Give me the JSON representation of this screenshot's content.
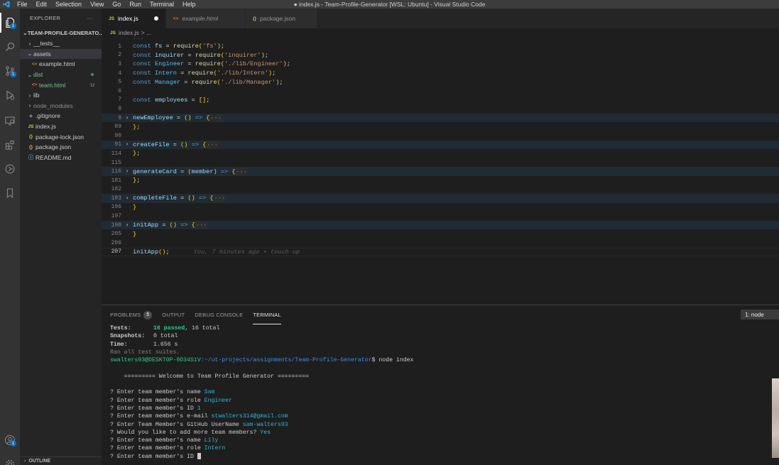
{
  "titlebar": {
    "menu": [
      "File",
      "Edit",
      "Selection",
      "View",
      "Go",
      "Run",
      "Terminal",
      "Help"
    ],
    "title": "● index.js - Team-Profile-Generator [WSL: Ubuntu] - Visual Studio Code"
  },
  "activity": {
    "explorer_badge": "1",
    "scm_badge": "1",
    "accounts_badge": "1"
  },
  "sidebar": {
    "header": "EXPLORER",
    "more": "···",
    "root": "TEAM-PROFILE-GENERATO...",
    "items": [
      {
        "label": "__tests__",
        "chev": "›",
        "indent": 1,
        "icon": ""
      },
      {
        "label": "assets",
        "chev": "⌄",
        "indent": 1,
        "icon": ""
      },
      {
        "label": "example.html",
        "chev": "",
        "indent": 2,
        "icon": "<>"
      },
      {
        "label": "dist",
        "chev": "⌄",
        "indent": 1,
        "icon": ""
      },
      {
        "label": "team.html",
        "chev": "",
        "indent": 2,
        "icon": "<>",
        "decor": "U"
      },
      {
        "label": "lib",
        "chev": "›",
        "indent": 1,
        "icon": ""
      },
      {
        "label": "node_modules",
        "chev": "›",
        "indent": 1,
        "icon": ""
      },
      {
        "label": ".gitignore",
        "chev": "",
        "indent": 1,
        "icon": "◆"
      },
      {
        "label": "index.js",
        "chev": "",
        "indent": 1,
        "icon": "JS"
      },
      {
        "label": "package-lock.json",
        "chev": "",
        "indent": 1,
        "icon": "{}"
      },
      {
        "label": "package.json",
        "chev": "",
        "indent": 1,
        "icon": "{}"
      },
      {
        "label": "README.md",
        "chev": "",
        "indent": 1,
        "icon": "ⓘ"
      }
    ],
    "outline": "OUTLINE"
  },
  "tabs": [
    {
      "icon": "JS",
      "label": "index.js"
    },
    {
      "icon": "<>",
      "label": "example.html"
    },
    {
      "icon": "{}",
      "label": "package.json"
    }
  ],
  "breadcrumb": {
    "icon": "JS",
    "file": "index.js",
    "rest": "> ..."
  },
  "code": {
    "top_ellipsis": "...",
    "lines": [
      {
        "n": "1",
        "t": "const fs = require('fs');"
      },
      {
        "n": "2",
        "t": "const inquirer = require('inquirer');"
      },
      {
        "n": "3",
        "t": "const Engineer = require('./lib/Engineer');"
      },
      {
        "n": "4",
        "t": "const Intern = require('./lib/Intern');"
      },
      {
        "n": "5",
        "t": "const Manager = require('./lib/Manager');"
      },
      {
        "n": "6",
        "t": ""
      },
      {
        "n": "7",
        "t": "const employees = [];"
      },
      {
        "n": "8",
        "t": ""
      },
      {
        "n": "9",
        "t": "newEmployee = () => {···"
      },
      {
        "n": "89",
        "t": "};"
      },
      {
        "n": "90",
        "t": ""
      },
      {
        "n": "91",
        "t": "createFile = () => {···"
      },
      {
        "n": "114",
        "t": "};"
      },
      {
        "n": "115",
        "t": ""
      },
      {
        "n": "116",
        "t": "generateCard = (member) => {···"
      },
      {
        "n": "181",
        "t": "};"
      },
      {
        "n": "182",
        "t": ""
      },
      {
        "n": "183",
        "t": "completeFile = () => {···"
      },
      {
        "n": "196",
        "t": "}"
      },
      {
        "n": "197",
        "t": ""
      },
      {
        "n": "198",
        "t": "initApp = () => {···"
      },
      {
        "n": "205",
        "t": "}"
      },
      {
        "n": "206",
        "t": ""
      },
      {
        "n": "207",
        "t": "initApp();"
      }
    ],
    "blame": "You, 7 minutes ago • touch up"
  },
  "panel": {
    "tabs": [
      "PROBLEMS",
      "OUTPUT",
      "DEBUG CONSOLE",
      "TERMINAL"
    ],
    "problems_count": "5",
    "terminal_select": "1: node"
  },
  "terminal": {
    "tests_label": "Tests:",
    "tests_passed": "16 passed",
    "tests_total": ", 16 total",
    "snapshots_label": "Snapshots:",
    "snapshots_value": "0 total",
    "time_label": "Time:",
    "time_value": "1.656 s",
    "ran_all": "Ran all test suites.",
    "prompt_user": "swalters93@DESKTOP-9D34S1V",
    "prompt_path": ":~/ut-projects/assignments/Team-Profile-Generator",
    "prompt_cmd": "$ node index",
    "welcome": "    ========= Welcome to Team Profile Generator =========",
    "qa": [
      {
        "q": "? Enter team member's name ",
        "a": "Sam"
      },
      {
        "q": "? Enter team member's role ",
        "a": "Engineer"
      },
      {
        "q": "? Enter team member's ID ",
        "a": "1"
      },
      {
        "q": "? Enter team member's e-mail ",
        "a": "stwalters314@gmail.com"
      },
      {
        "q": "? Enter Team Member's GitHub UserName ",
        "a": "sam-walters93"
      },
      {
        "q": "? Would you like to add more team members? ",
        "a": "Yes"
      },
      {
        "q": "? Enter team member's name ",
        "a": "Lily"
      },
      {
        "q": "? Enter team member's role ",
        "a": "Intern"
      },
      {
        "q": "? Enter team member's ID ",
        "a": ""
      }
    ]
  }
}
